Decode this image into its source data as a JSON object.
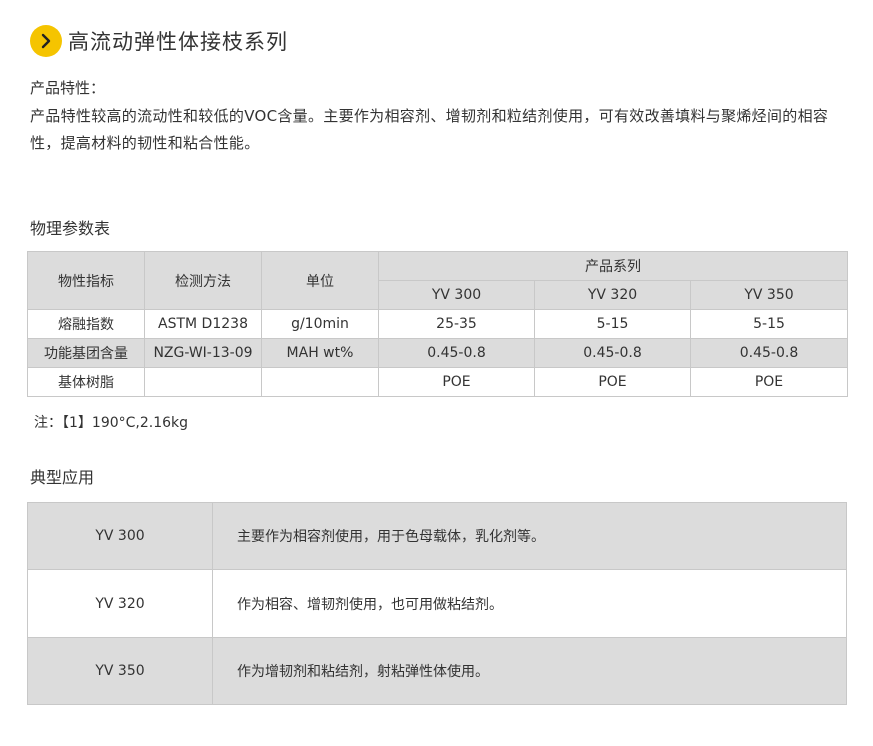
{
  "header": {
    "title": "高流动弹性体接枝系列",
    "icon": "chevron-right-icon",
    "accent_color": "#f5c400"
  },
  "features": {
    "label": "产品特性：",
    "text": "产品特性较高的流动性和较低的VOC含量。主要作为相容剂、增韧剂和粒结剂使用，可有效改善填料与聚烯烃间的相容性，提高材料的韧性和粘合性能。"
  },
  "params": {
    "heading": "物理参数表",
    "headers": {
      "property": "物性指标",
      "method": "检测方法",
      "unit": "单位",
      "series": "产品系列",
      "models": [
        "YV 300",
        "YV 320",
        "YV 350"
      ]
    },
    "rows": [
      {
        "property": "熔融指数",
        "method": "ASTM D1238",
        "unit": "g/10min",
        "values": [
          "25-35",
          "5-15",
          "5-15"
        ]
      },
      {
        "property": "功能基团含量",
        "method": "NZG-WI-13-09",
        "unit": "MAH wt%",
        "values": [
          "0.45-0.8",
          "0.45-0.8",
          "0.45-0.8"
        ]
      },
      {
        "property": "基体树脂",
        "method": "",
        "unit": "",
        "values": [
          "POE",
          "POE",
          "POE"
        ]
      }
    ],
    "note": "注：【1】190°C,2.16kg"
  },
  "applications": {
    "heading": "典型应用",
    "rows": [
      {
        "model": "YV 300",
        "desc": "主要作为相容剂使用，用于色母载体，乳化剂等。"
      },
      {
        "model": "YV 320",
        "desc": "作为相容、增韧剂使用，也可用做粘结剂。"
      },
      {
        "model": "YV 350",
        "desc": "作为增韧剂和粘结剂，射粘弹性体使用。"
      }
    ]
  }
}
